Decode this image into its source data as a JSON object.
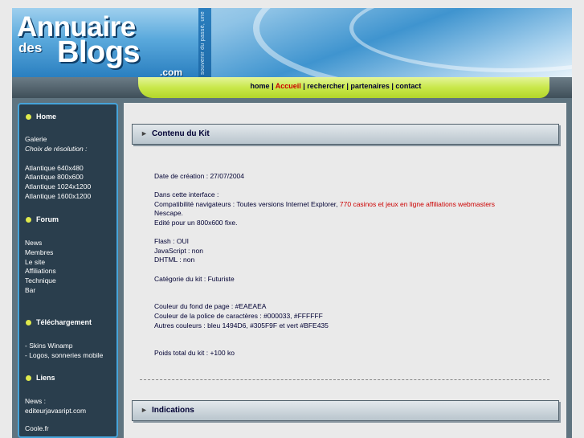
{
  "header": {
    "logo_line1": "Annuaire",
    "logo_des": "des",
    "logo_blogs": "Blogs",
    "logo_com": ".com",
    "tagline": "souvenir du passé, une"
  },
  "nav": [
    {
      "label": "home",
      "active": false
    },
    {
      "label": "Accueil",
      "active": true
    },
    {
      "label": "rechercher",
      "active": false
    },
    {
      "label": "partenaires",
      "active": false
    },
    {
      "label": "contact",
      "active": false
    }
  ],
  "nav_separator": " | ",
  "sidebar": {
    "home": {
      "title": "Home",
      "items": [
        "Galerie"
      ],
      "resolution_label": "Choix de résolution :",
      "resolutions": [
        "Atlantique 640x480",
        "Atlantique 800x600",
        "Atlantique 1024x1200",
        "Atlantique 1600x1200"
      ]
    },
    "forum": {
      "title": "Forum",
      "items": [
        "News",
        "Membres",
        "Le site",
        "Affiliations",
        "Technique",
        "Bar"
      ]
    },
    "telechargement": {
      "title": "Téléchargement",
      "items": [
        "- Skins Winamp",
        "- Logos, sonneries mobile"
      ]
    },
    "liens": {
      "title": "Liens",
      "items": [
        "News :",
        "editeurjavasript.com"
      ]
    },
    "more": "Coole.fr"
  },
  "content": {
    "panel1_title": "Contenu du Kit",
    "panel2_title": "Indications",
    "arrow": "►",
    "kit": {
      "date": "Date de création : 27/07/2004",
      "interface_label": "Dans cette interface :",
      "compat": "Compatibilité navigateurs : Toutes versions Internet Explorer,",
      "compat_link": "770 casinos et jeux en ligne affiliations webmasters",
      "nescape": "Nescape.",
      "edite": "Edité pour un 800x600 fixe.",
      "flash": "Flash : OUI",
      "javascript": "JavaScript : non",
      "dhtml": "DHTML : non",
      "categorie": "Catégorie du kit : Futuriste",
      "fond": "Couleur du fond de page : #EAEAEA",
      "police": "Couleur de la police de caractères : #000033, #FFFFFF",
      "autres": "Autres couleurs : bleu 1494D6, #305F9F et vert #BFE435",
      "poids": "Poids total du kit : +100 ko"
    }
  },
  "colors": {
    "page_bg": "#EAEAEA",
    "text": "#000033",
    "accent_green": "#BFE435",
    "accent_blue": "#1494D6",
    "dark_blue": "#305F9F",
    "link_red": "#cc0000"
  }
}
